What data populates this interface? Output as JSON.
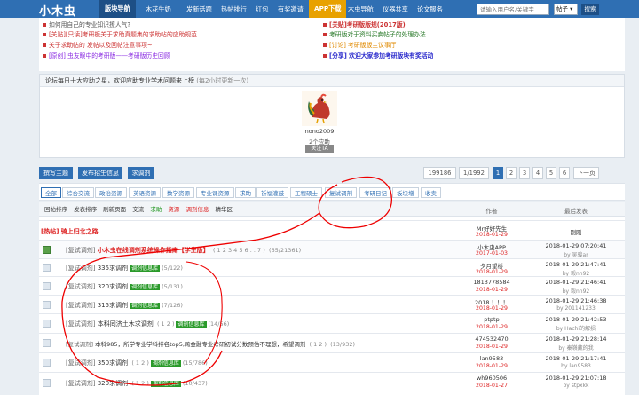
{
  "nav": {
    "logo": "小木虫",
    "items": [
      "版块导航",
      "木花牛奶",
      "发新话题",
      "热帖排行",
      "红包",
      "有奖邀请",
      "APP下载",
      "木虫导航",
      "仪器共享",
      "论文服务"
    ],
    "search_placeholder": "请输入用户名/关键字",
    "search_scope": "帖子",
    "search_button": "搜索"
  },
  "announcements": [
    "如何用自己的专业知识撩人气?",
    "[关贴][只读]考研板关于求助真题集的求助帖的应助规范",
    "关于求助帖的 发帖以及回帖注意事项~",
    "[原创] 虫友眼中的考研版——考研版历史回顾",
    "[关贴]考研版版规(2017版)",
    "考研版对于资料买卖帖子的处理办法",
    "[讨论] 考研版版主议事厅",
    "[分享] 欢迎大家参加考研版块有奖活动"
  ],
  "forum": {
    "title": "论坛每日十大应助之星，欢迎应助专业学术问题来上榜",
    "subtitle": "(每2小时更新一次)",
    "user": "nono2009",
    "info": "2个应助",
    "follow": "关注TA"
  },
  "actions": {
    "post_topic": "撰写主题",
    "post_recruit": "发布招生信息",
    "ask_help": "求调剂"
  },
  "pager": {
    "total": "199186",
    "position": "1/1992",
    "pages": [
      "1",
      "2",
      "3",
      "4",
      "5",
      "6"
    ],
    "next": "下一页"
  },
  "tabs": [
    "全部",
    "综合交流",
    "政治资源",
    "英语资源",
    "数学资源",
    "专业课资源",
    "求助",
    "祈福灌鼓",
    "工程硕士",
    "复试调剂",
    "考研日记",
    "板块增",
    "收卖"
  ],
  "sortbar": {
    "items": [
      "回帖排序",
      "发表排序",
      "刷新页面",
      "交流",
      "求助",
      "资源",
      "调剂信息",
      "精华区"
    ]
  },
  "table": {
    "col_author": "作者",
    "col_last": "最后发表",
    "rows": [
      {
        "prefix": "[热帖]",
        "title": "骑上归北之路",
        "author": "Mr好好先生",
        "date": "2018-01-29",
        "last": "刚刚",
        "last_by": ""
      },
      {
        "prefix": "[复试调剂]",
        "title": "小木虫在线调剂系统操作指南【学生版】",
        "pages": "( 1 2 3 4 5 6 . . 7 )",
        "count": "(65/21361)",
        "author": "小木虫APP",
        "date": "2017-01-03",
        "last": "2018-01-29 07:20:41",
        "last_by": "by 吴骏ar"
      },
      {
        "prefix": "[复试调剂]",
        "title": "335求调剂",
        "tag": "调剂信息库",
        "count": "(5/122)",
        "author": "夕月望桥",
        "date": "2018-01-29",
        "last": "2018-01-29 21:47:41",
        "last_by": "by 毅nn92"
      },
      {
        "prefix": "[复试调剂]",
        "title": "320求调剂",
        "tag": "调剂信息库",
        "count": "(5/131)",
        "author": "1813778584",
        "date": "2018-01-29",
        "last": "2018-01-29 21:46:41",
        "last_by": "by 毅nn92"
      },
      {
        "prefix": "[复试调剂]",
        "title": "315求调剂",
        "tag": "调剂信息库",
        "count": "(7/126)",
        "author": "2018 ！！！",
        "date": "2018-01-29",
        "last": "2018-01-29 21:46:38",
        "last_by": "by 201141233"
      },
      {
        "prefix": "[复试调剂]",
        "title": "本科同济土木求调剂",
        "pages": "( 1 2 )",
        "tag": "调剂信息库",
        "count": "(14/56)",
        "author": "ptptp",
        "date": "2018-01-29",
        "last": "2018-01-29 21:42:53",
        "last_by": "by Hachi的解损"
      },
      {
        "prefix": "[复试调剂]",
        "title": "本科985，所学专业学科排名top5,跨金融专业考研初试分数预估不理想，希望调剂",
        "pages": "( 1 2 )",
        "count": "(13/932)",
        "author": "474532470",
        "date": "2018-01-29",
        "last": "2018-01-29 21:28:14",
        "last_by": "by 秦嶺藏的我"
      },
      {
        "prefix": "[复试调剂]",
        "title": "350求调剂",
        "pages": "( 1 2 )",
        "tag": "调剂信息库",
        "count": "(15/786)",
        "author": "lan9583",
        "date": "2018-01-29",
        "last": "2018-01-29 21:17:41",
        "last_by": "by lan9583"
      },
      {
        "prefix": "[复试调剂]",
        "title": "320求调剂",
        "pages": "( 1 2 )",
        "tag": "调剂信息库",
        "count": "(10/437)",
        "author": "wh960506",
        "date": "2018-01-27",
        "last": "2018-01-29 21:07:18",
        "last_by": "by stpxkk"
      }
    ]
  }
}
